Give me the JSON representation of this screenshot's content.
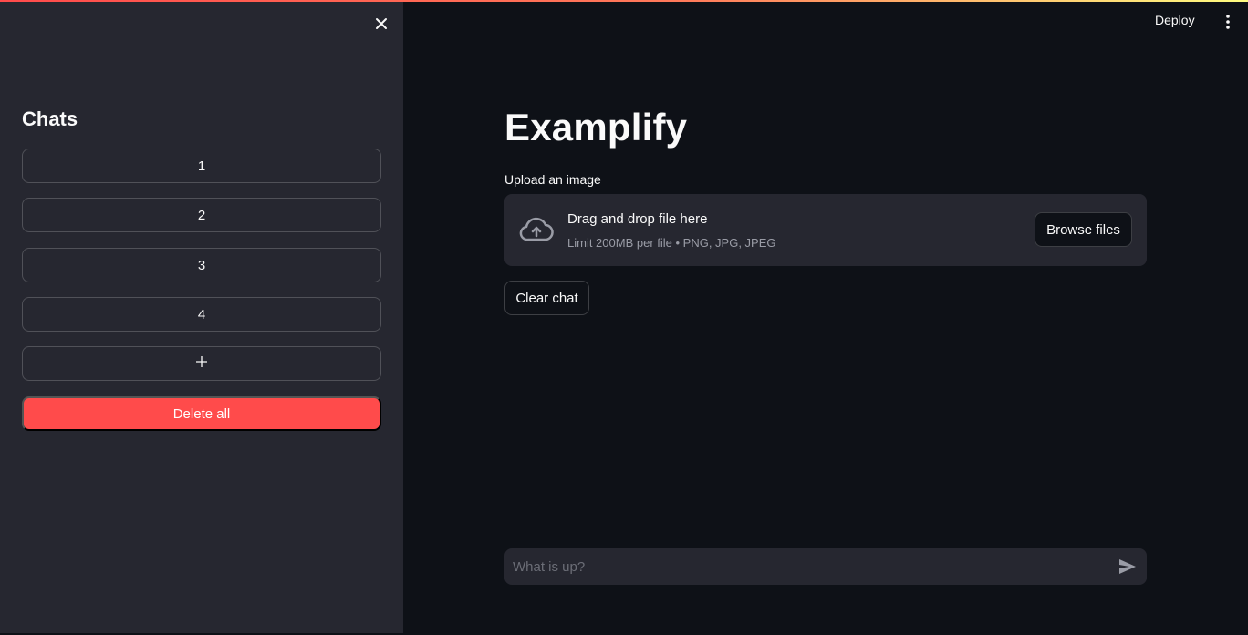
{
  "sidebar": {
    "title": "Chats",
    "chats": [
      "1",
      "2",
      "3",
      "4"
    ],
    "add_label": "+",
    "delete_all_label": "Delete all"
  },
  "header": {
    "deploy_label": "Deploy"
  },
  "main": {
    "title": "Examplify",
    "upload": {
      "label": "Upload an image",
      "drop_title": "Drag and drop file here",
      "limit_text": "Limit 200MB per file • PNG, JPG, JPEG",
      "browse_label": "Browse files"
    },
    "clear_chat_label": "Clear chat",
    "chat_input": {
      "placeholder": "What is up?",
      "value": ""
    }
  },
  "colors": {
    "background": "#0e1117",
    "sidebar": "#262730",
    "accent": "#ff4b4b"
  },
  "icons": {
    "close": "close-icon",
    "menu": "kebab-menu-icon",
    "upload": "cloud-upload-icon",
    "send": "send-icon"
  }
}
